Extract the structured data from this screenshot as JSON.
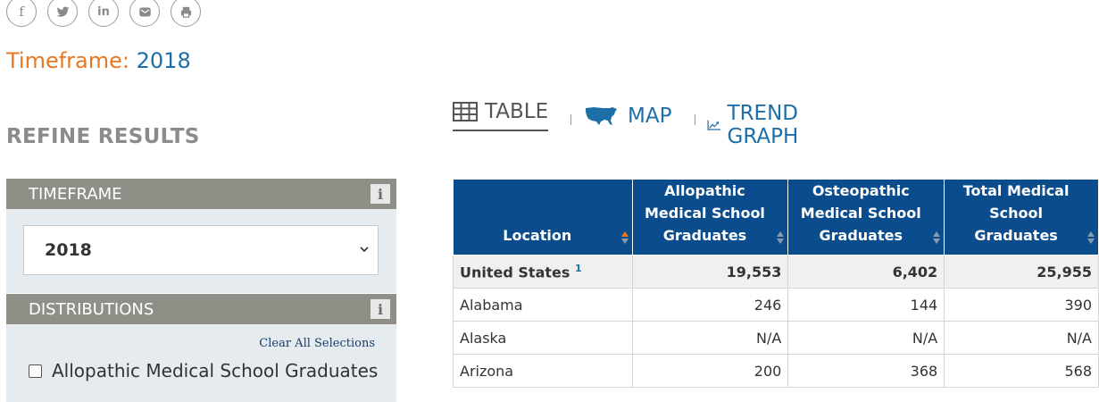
{
  "share": {
    "icons": [
      "facebook-icon",
      "twitter-icon",
      "linkedin-icon",
      "email-icon",
      "print-icon"
    ],
    "facebook_glyph": "f",
    "twitter_glyph": "",
    "linkedin_glyph": "in"
  },
  "heading": {
    "timeframe_label": "Timeframe:",
    "timeframe_value": "2018"
  },
  "sidebar": {
    "refine_title": "REFINE RESULTS",
    "timeframe_panel": {
      "title": "TIMEFRAME",
      "selected": "2018"
    },
    "distributions_panel": {
      "title": "DISTRIBUTIONS",
      "clear_all": "Clear All Selections",
      "options": [
        "Allopathic Medical School Graduates"
      ]
    },
    "info_glyph": "i"
  },
  "tabs": {
    "table": "TABLE",
    "map": "MAP",
    "trend": "TREND GRAPH"
  },
  "table": {
    "headers": [
      "Location",
      "Allopathic Medical School Graduates",
      "Osteopathic Medical School Graduates",
      "Total Medical School Graduates"
    ],
    "rows": [
      {
        "location": "United States",
        "footnote": "1",
        "allopathic": "19,553",
        "osteopathic": "6,402",
        "total": "25,955"
      },
      {
        "location": "Alabama",
        "allopathic": "246",
        "osteopathic": "144",
        "total": "390"
      },
      {
        "location": "Alaska",
        "allopathic": "N/A",
        "osteopathic": "N/A",
        "total": "N/A"
      },
      {
        "location": "Arizona",
        "allopathic": "200",
        "osteopathic": "368",
        "total": "568"
      }
    ]
  },
  "colors": {
    "accent_orange": "#e87722",
    "link_blue": "#1d6fa8",
    "header_navy": "#0b4d8c",
    "panel_gray": "#8f8f87",
    "panel_bg": "#e5ebee"
  }
}
